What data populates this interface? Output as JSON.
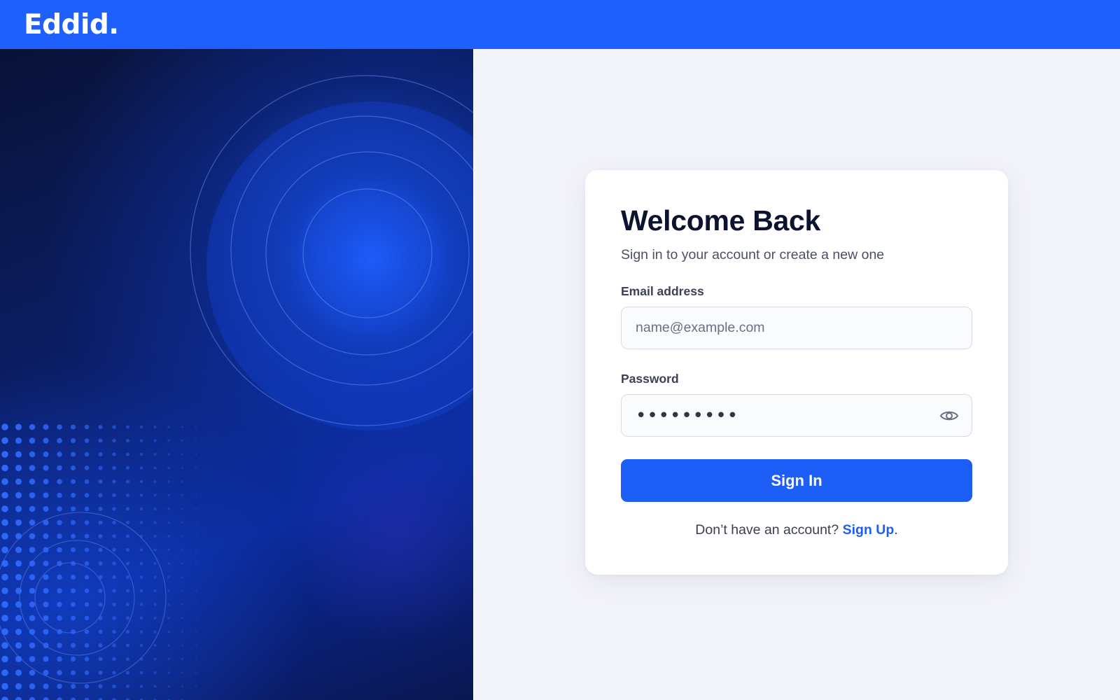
{
  "header": {
    "logo_text": "Eddid.",
    "brand_color": "#1f5ffb"
  },
  "login_card": {
    "title": "Welcome Back",
    "subtitle": "Sign in to your account or create a new one",
    "email": {
      "label": "Email address",
      "placeholder": "name@example.com",
      "value": ""
    },
    "password": {
      "label": "Password",
      "masked_value": "•••••••••",
      "toggle_icon": "eye-icon"
    },
    "submit_label": "Sign In",
    "signup_prompt": "Don’t have an account?",
    "signup_link": "Sign Up",
    "signup_suffix": ".",
    "accent_color": "#1d5ef7"
  }
}
